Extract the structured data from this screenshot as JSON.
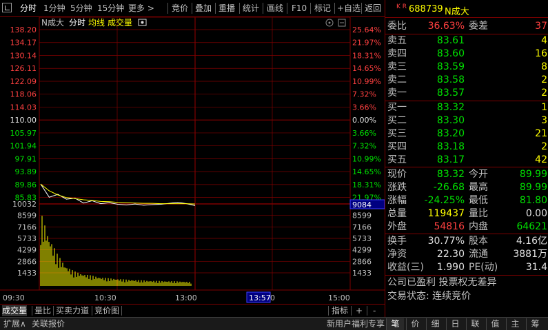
{
  "toolbar": {
    "items": [
      "分时",
      "1分钟",
      "5分钟",
      "15分钟",
      "更多 >",
      "竞价",
      "叠加",
      "重播",
      "统计",
      "画线",
      "F10",
      "标记",
      "+自选",
      "返回"
    ]
  },
  "chart": {
    "legend_name": "N成大",
    "legend_fenshi": "分时",
    "legend_junxian": "均线",
    "legend_volume": "成交量",
    "price_labels_left": [
      "138.20",
      "134.17",
      "130.14",
      "126.11",
      "122.09",
      "118.06",
      "114.03",
      "110.00",
      "105.97",
      "101.94",
      "97.91",
      "93.89",
      "89.86",
      "85.83"
    ],
    "pct_labels_right": [
      "25.64%",
      "21.97%",
      "18.31%",
      "14.65%",
      "10.99%",
      "7.32%",
      "3.66%",
      "0.00%",
      "3.66%",
      "7.32%",
      "10.99%",
      "14.65%",
      "18.31%",
      "21.97%"
    ],
    "volume_labels_left": [
      "10032",
      "8599",
      "7166",
      "5733",
      "4299",
      "2866",
      "1433"
    ],
    "volume_labels_right": [
      "8599",
      "7166",
      "5733",
      "4299",
      "2866",
      "1433"
    ],
    "volume_highlight": "9084",
    "time_labels": [
      "09:30",
      "10:30",
      "13:00",
      "15:00"
    ],
    "cursor_time": "13:57",
    "cursor_time_suffix": "0"
  },
  "chart_data": {
    "type": "line",
    "title": "N成大",
    "price_axis": {
      "min": 85.83,
      "max": 138.2,
      "prev_close": 110.0
    },
    "volume_axis": {
      "min": 0,
      "max": 10032
    },
    "x": [
      "09:30",
      "09:35",
      "09:40",
      "09:45",
      "09:50",
      "09:55",
      "10:00",
      "10:10",
      "10:20",
      "10:30",
      "10:45",
      "11:00",
      "11:15",
      "11:30",
      "13:00",
      "13:15",
      "13:30",
      "13:45",
      "13:57"
    ],
    "series": [
      {
        "name": "分时",
        "values": [
          90.0,
          85.9,
          86.8,
          85.3,
          85.6,
          84.1,
          84.8,
          83.9,
          84.2,
          83.7,
          83.5,
          83.8,
          83.4,
          83.6,
          83.7,
          84.0,
          84.3,
          83.9,
          83.3
        ]
      },
      {
        "name": "均线",
        "values": [
          90.0,
          87.9,
          86.6,
          85.8,
          85.5,
          85.1,
          84.9,
          84.6,
          84.5,
          84.3,
          84.2,
          84.1,
          84.0,
          84.0,
          83.9,
          83.9,
          83.9,
          83.9,
          83.8
        ]
      },
      {
        "name": "成交量",
        "values": [
          9084,
          6200,
          3900,
          2500,
          1800,
          1500,
          1300,
          1100,
          950,
          900,
          800,
          750,
          700,
          650,
          620,
          600,
          580,
          550,
          500
        ]
      }
    ]
  },
  "tabs": {
    "items": [
      "成交量",
      "量比",
      "买卖力道",
      "竞价图"
    ],
    "right": [
      "指标",
      "+",
      "-"
    ]
  },
  "statusbar": {
    "expand": "扩展∧",
    "related": "关联报价",
    "promo": "新用户福利专享",
    "tabs": [
      "笔",
      "价",
      "细",
      "日",
      "联",
      "值",
      "主",
      "筹"
    ]
  },
  "quote": {
    "kr": "K R",
    "code": "688739",
    "name": "N成大",
    "weibi_label": "委比",
    "weibi_value": "36.63%",
    "weicha_label": "委差",
    "weicha_value": "37",
    "sell": [
      {
        "label": "卖五",
        "price": "83.61",
        "vol": "4"
      },
      {
        "label": "卖四",
        "price": "83.60",
        "vol": "16"
      },
      {
        "label": "卖三",
        "price": "83.59",
        "vol": "8"
      },
      {
        "label": "卖二",
        "price": "83.58",
        "vol": "2"
      },
      {
        "label": "卖一",
        "price": "83.57",
        "vol": "2"
      }
    ],
    "buy": [
      {
        "label": "买一",
        "price": "83.32",
        "vol": "1"
      },
      {
        "label": "买二",
        "price": "83.30",
        "vol": "3"
      },
      {
        "label": "买三",
        "price": "83.20",
        "vol": "21"
      },
      {
        "label": "买四",
        "price": "83.18",
        "vol": "2"
      },
      {
        "label": "买五",
        "price": "83.17",
        "vol": "42"
      }
    ],
    "stats": [
      {
        "l1": "现价",
        "v1": "83.32",
        "c1": "green",
        "l2": "今开",
        "v2": "89.99",
        "c2": "green"
      },
      {
        "l1": "涨跌",
        "v1": "-26.68",
        "c1": "green",
        "l2": "最高",
        "v2": "89.99",
        "c2": "green"
      },
      {
        "l1": "涨幅",
        "v1": "-24.25%",
        "c1": "green",
        "l2": "最低",
        "v2": "81.80",
        "c2": "green"
      },
      {
        "l1": "总量",
        "v1": "119437",
        "c1": "yellow",
        "l2": "量比",
        "v2": "0.00",
        "c2": "white"
      },
      {
        "l1": "外盘",
        "v1": "54816",
        "c1": "red",
        "l2": "内盘",
        "v2": "64621",
        "c2": "green"
      }
    ],
    "stats2": [
      {
        "l1": "换手",
        "v1": "30.77%",
        "l2": "股本",
        "v2": "4.16亿"
      },
      {
        "l1": "净资",
        "v1": "22.30",
        "l2": "流通",
        "v2": "3881万"
      },
      {
        "l1": "收益(三)",
        "v1": "1.990",
        "l2": "PE(动)",
        "v2": "31.4"
      }
    ],
    "note1": "公司已盈利 投票权无差异",
    "note2": "交易状态: 连续竞价"
  },
  "colors": {
    "up": "#ff4040",
    "down": "#00e000",
    "frame": "#800000",
    "volume": "#ffff00"
  }
}
